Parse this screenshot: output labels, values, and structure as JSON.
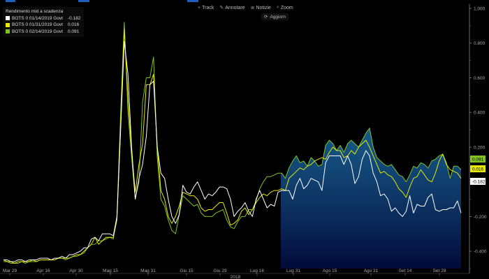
{
  "toolbar": {
    "items": [
      {
        "label": "Track",
        "icon": "plus-icon"
      },
      {
        "label": "Annotare",
        "icon": "pencil-icon"
      },
      {
        "label": "Notizie",
        "icon": "news-icon"
      },
      {
        "label": "Zoom",
        "icon": "magnifier-icon"
      }
    ],
    "refresh_label": "Aggiorn"
  },
  "legend": {
    "title": "Rendimento mid a scadenza",
    "entries": [
      {
        "label": "BOTS 0 01/14/2019 Govt",
        "value": "-0.182",
        "color": "#ffffff"
      },
      {
        "label": "BOTS 0 01/31/2019 Govt",
        "value": "0.016",
        "color": "#e8e800"
      },
      {
        "label": "BOTS 0 02/14/2019 Govt",
        "value": "0.091",
        "color": "#7fc31c"
      }
    ]
  },
  "chart_data": {
    "type": "line",
    "xlabel": "2018",
    "x_ticks": [
      "Mar 29",
      "Apr 16",
      "Apr 30",
      "Mag 15",
      "Mag 31",
      "Giu 15",
      "Giu 29",
      "Lug 16",
      "Lug 31",
      "Ago 15",
      "Ago 31",
      "Set 14",
      "Set 28"
    ],
    "y_ticks": [
      "1.000",
      "0.800",
      "0.600",
      "0.400",
      "0.200",
      "-0.200",
      "-0.400"
    ],
    "ylim": [
      -0.5,
      1.0
    ],
    "shaded_from": "Lug 21",
    "last_values": [
      "0.091",
      "0.016",
      "-0.182"
    ],
    "series": [
      {
        "name": "BOTS 0 01/14/2019 Govt",
        "color": "#ffffff",
        "values": [
          -0.45,
          -0.45,
          -0.46,
          -0.46,
          -0.45,
          -0.45,
          -0.46,
          -0.45,
          -0.45,
          -0.45,
          -0.44,
          -0.44,
          -0.44,
          -0.45,
          -0.44,
          -0.44,
          -0.43,
          -0.44,
          -0.42,
          -0.42,
          -0.41,
          -0.4,
          -0.38,
          -0.38,
          -0.33,
          -0.32,
          -0.34,
          -0.3,
          -0.3,
          -0.3,
          -0.31,
          -0.2,
          0.3,
          0.81,
          0.62,
          0.2,
          -0.1,
          0.02,
          0.1,
          0.26,
          0.56,
          0.58,
          0.2,
          0.05,
          0.02,
          -0.1,
          -0.2,
          -0.24,
          -0.19,
          -0.02,
          -0.06,
          -0.07,
          -0.03,
          0.0,
          -0.05,
          -0.1,
          -0.07,
          -0.08,
          -0.06,
          -0.03,
          -0.03,
          -0.04,
          -0.1,
          -0.2,
          -0.17,
          -0.15,
          -0.12,
          -0.17,
          -0.2,
          -0.1,
          -0.05,
          -0.1,
          -0.15,
          -0.13,
          -0.14,
          -0.06,
          -0.05,
          -0.05,
          -0.05,
          -0.1,
          -0.02,
          0.02,
          -0.04,
          -0.02,
          0.02,
          0.01,
          0.0,
          -0.05,
          0.11,
          0.15,
          0.15,
          0.15,
          0.15,
          0.1,
          0.15,
          0.1,
          -0.01,
          0.03,
          0.13,
          0.18,
          0.15,
          0.05,
          0.0,
          -0.08,
          -0.07,
          -0.1,
          -0.17,
          -0.15,
          -0.18,
          -0.2,
          -0.17,
          -0.08,
          -0.18,
          -0.13,
          -0.14,
          -0.14,
          -0.09,
          -0.07,
          -0.16,
          -0.17,
          -0.16,
          -0.16,
          -0.15,
          -0.15,
          -0.11,
          -0.18
        ]
      },
      {
        "name": "BOTS 0 01/31/2019 Govt",
        "color": "#e8e800",
        "values": [
          -0.45,
          -0.46,
          -0.46,
          -0.47,
          -0.46,
          -0.46,
          -0.46,
          -0.46,
          -0.45,
          -0.46,
          -0.45,
          -0.45,
          -0.45,
          -0.45,
          -0.45,
          -0.44,
          -0.44,
          -0.44,
          -0.44,
          -0.43,
          -0.42,
          -0.42,
          -0.4,
          -0.38,
          -0.36,
          -0.32,
          -0.36,
          -0.34,
          -0.32,
          -0.32,
          -0.32,
          -0.22,
          0.32,
          0.88,
          0.48,
          0.18,
          -0.06,
          0.1,
          0.22,
          0.56,
          0.56,
          0.62,
          0.2,
          -0.05,
          -0.1,
          -0.2,
          -0.24,
          -0.2,
          -0.14,
          -0.06,
          -0.07,
          -0.08,
          -0.08,
          -0.1,
          -0.15,
          -0.17,
          -0.16,
          -0.16,
          -0.14,
          -0.12,
          -0.12,
          -0.18,
          -0.25,
          -0.24,
          -0.22,
          -0.17,
          -0.15,
          -0.19,
          -0.16,
          -0.12,
          -0.09,
          -0.07,
          -0.08,
          -0.06,
          -0.05,
          -0.05,
          -0.04,
          -0.05,
          0.02,
          0.04,
          0.06,
          0.08,
          0.07,
          0.09,
          0.1,
          0.12,
          0.13,
          0.14,
          0.13,
          0.17,
          0.2,
          0.18,
          0.18,
          0.14,
          0.15,
          0.18,
          0.16,
          0.2,
          0.22,
          0.24,
          0.2,
          0.15,
          0.1,
          0.05,
          0.06,
          0.04,
          0.03,
          0.0,
          -0.04,
          -0.06,
          -0.09,
          -0.03,
          0.02,
          0.03,
          0.07,
          0.04,
          0.01,
          0.0,
          0.05,
          0.12,
          0.16,
          0.1,
          0.07,
          0.06,
          0.05,
          0.02
        ]
      },
      {
        "name": "BOTS 0 02/14/2019 Govt",
        "color": "#7fc31c",
        "values": [
          -0.46,
          -0.46,
          -0.47,
          -0.47,
          -0.47,
          -0.46,
          -0.47,
          -0.46,
          -0.46,
          -0.46,
          -0.45,
          -0.45,
          -0.45,
          -0.45,
          -0.45,
          -0.44,
          -0.44,
          -0.45,
          -0.44,
          -0.43,
          -0.43,
          -0.42,
          -0.41,
          -0.38,
          -0.36,
          -0.36,
          -0.34,
          -0.34,
          -0.33,
          -0.32,
          -0.33,
          -0.2,
          0.4,
          0.92,
          0.4,
          0.14,
          -0.1,
          0.0,
          0.46,
          0.6,
          0.6,
          0.72,
          0.14,
          -0.1,
          -0.14,
          -0.22,
          -0.28,
          -0.3,
          -0.19,
          -0.08,
          -0.1,
          -0.12,
          -0.14,
          -0.13,
          -0.18,
          -0.2,
          -0.2,
          -0.2,
          -0.18,
          -0.17,
          -0.16,
          -0.22,
          -0.26,
          -0.27,
          -0.23,
          -0.2,
          -0.2,
          -0.16,
          -0.16,
          -0.11,
          -0.04,
          0.0,
          0.03,
          0.03,
          0.04,
          0.05,
          0.05,
          0.02,
          0.08,
          0.12,
          0.15,
          0.11,
          0.12,
          0.09,
          0.14,
          0.12,
          0.09,
          0.1,
          0.21,
          0.24,
          0.22,
          0.18,
          0.21,
          0.17,
          0.22,
          0.24,
          0.22,
          0.2,
          0.24,
          0.28,
          0.31,
          0.2,
          0.14,
          0.12,
          0.1,
          0.09,
          0.1,
          0.07,
          0.04,
          0.03,
          0.0,
          0.04,
          0.09,
          0.08,
          0.11,
          0.1,
          0.08,
          0.12,
          0.13,
          0.15,
          0.16,
          0.11,
          0.02,
          0.09,
          0.09,
          0.07
        ]
      }
    ]
  }
}
